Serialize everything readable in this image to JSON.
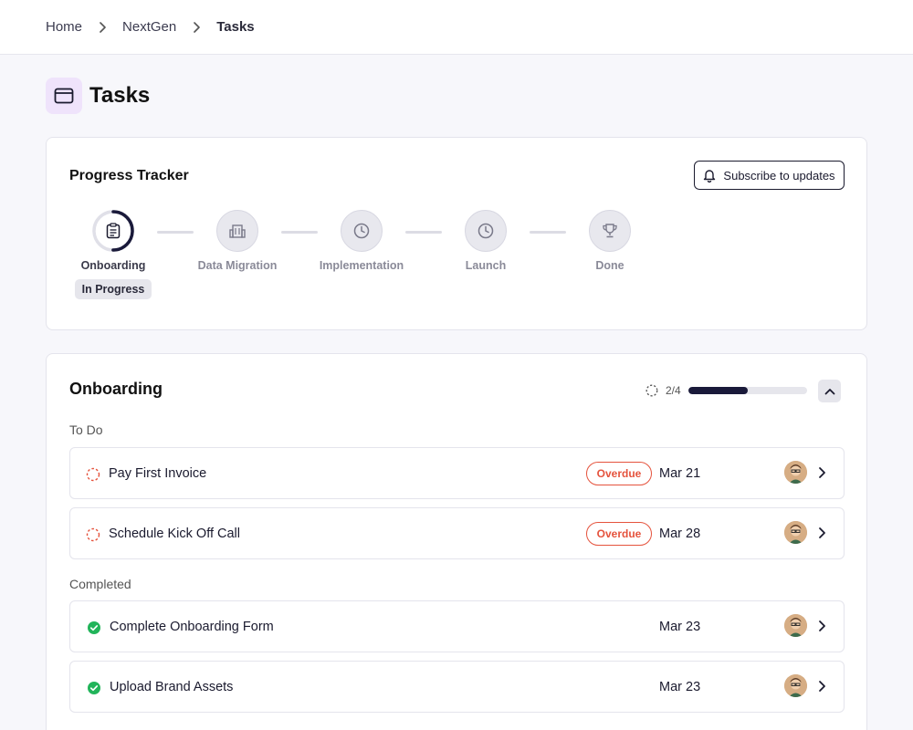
{
  "breadcrumb": {
    "home": "Home",
    "project": "NextGen",
    "current": "Tasks"
  },
  "page": {
    "title": "Tasks",
    "icon": "browser-window-icon"
  },
  "tracker": {
    "title": "Progress Tracker",
    "subscribe_label": "Subscribe to updates",
    "steps": [
      {
        "label": "Onboarding",
        "icon": "clipboard-icon",
        "status": "In Progress",
        "progress": 0.5
      },
      {
        "label": "Data Migration",
        "icon": "building-icon"
      },
      {
        "label": "Implementation",
        "icon": "clock-icon"
      },
      {
        "label": "Launch",
        "icon": "clock-icon"
      },
      {
        "label": "Done",
        "icon": "trophy-icon"
      }
    ]
  },
  "onboarding": {
    "title": "Onboarding",
    "progress_text": "2/4",
    "progress_fraction": 0.5,
    "todo_label": "To Do",
    "completed_label": "Completed",
    "todo": [
      {
        "name": "Pay First Invoice",
        "badge": "Overdue",
        "date": "Mar 21"
      },
      {
        "name": "Schedule Kick Off Call",
        "badge": "Overdue",
        "date": "Mar 28"
      }
    ],
    "completed": [
      {
        "name": "Complete Onboarding Form",
        "date": "Mar 23"
      },
      {
        "name": "Upload Brand Assets",
        "date": "Mar 23"
      }
    ]
  },
  "colors": {
    "accent": "#1a1a3a",
    "overdue": "#e5533d",
    "done": "#22b45a",
    "icon_bg": "#efe3fb"
  }
}
